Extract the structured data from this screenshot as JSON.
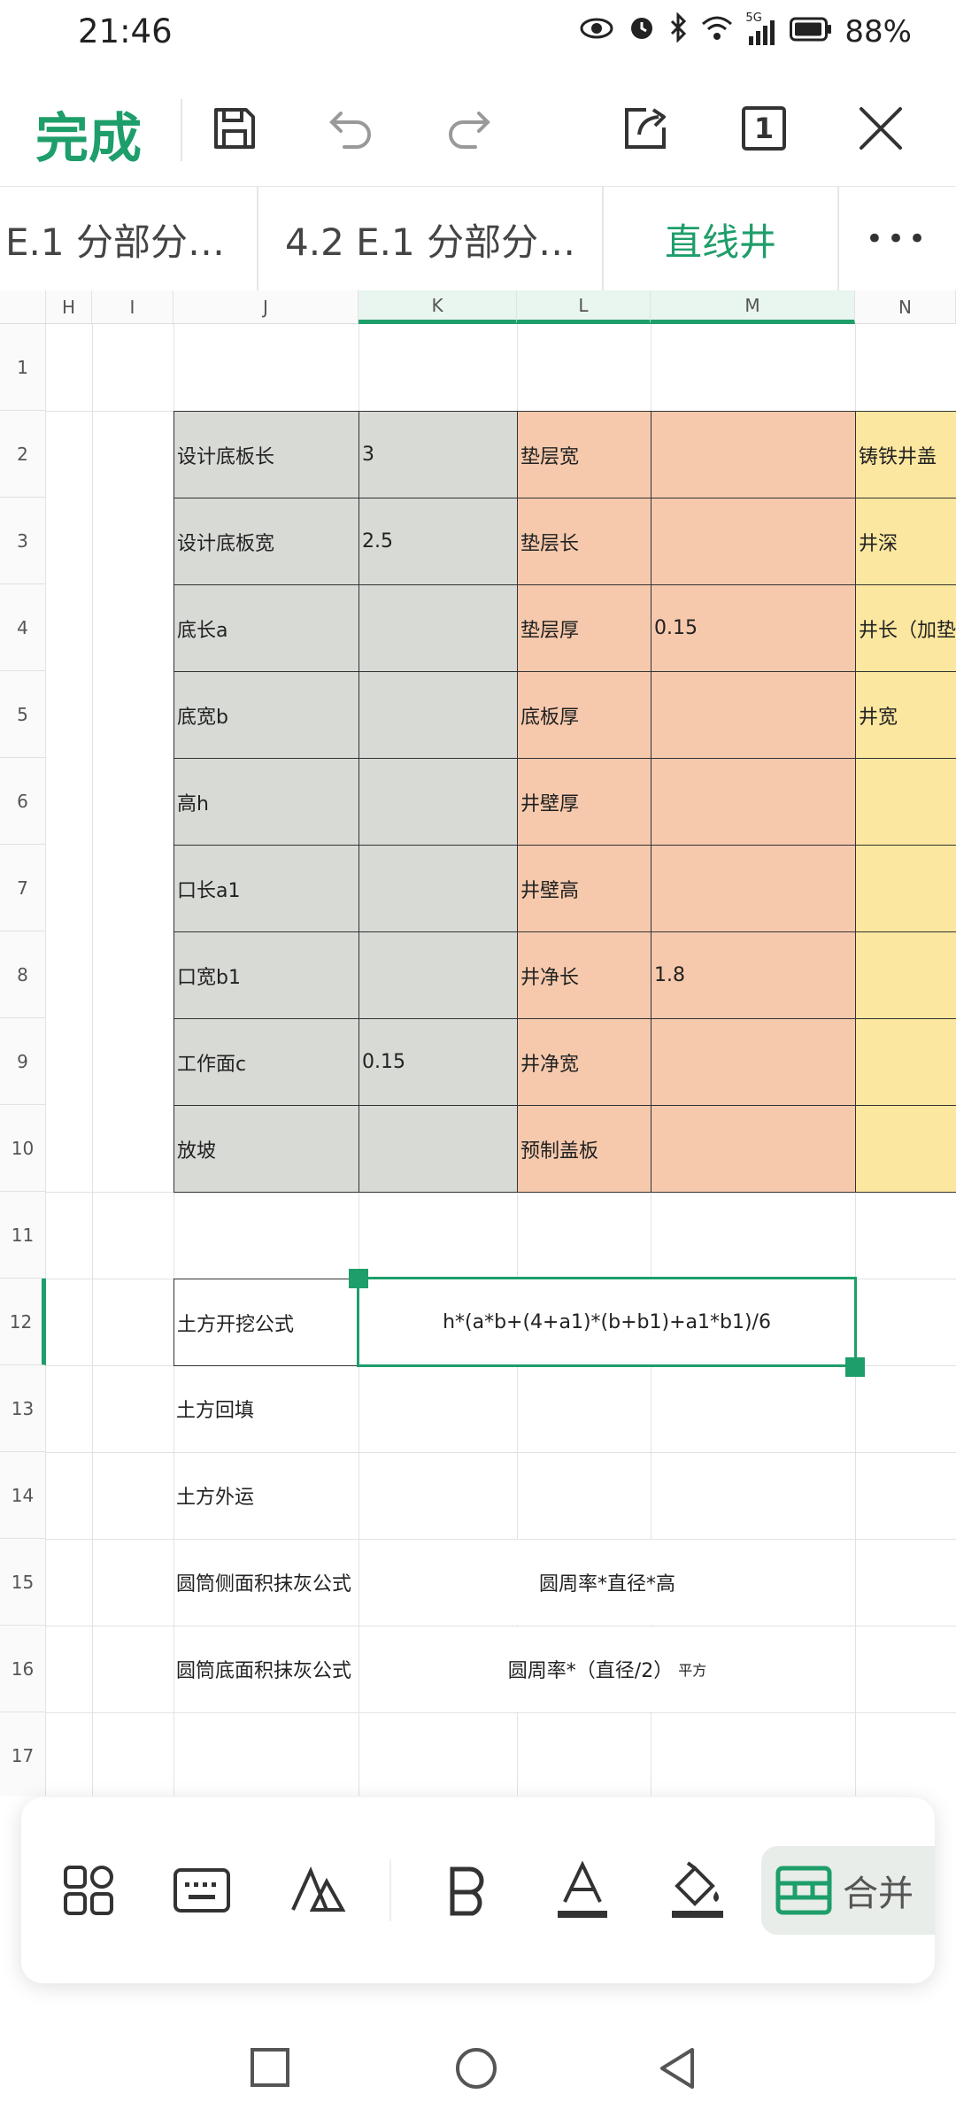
{
  "status_bar": {
    "time": "21:46",
    "battery": "88%",
    "network": "5G"
  },
  "toolbar": {
    "done_label": "完成",
    "page_count": "1",
    "icons": [
      "save-icon",
      "undo-icon",
      "redo-icon",
      "share-icon",
      "page-count-icon",
      "close-icon"
    ]
  },
  "sheet_tabs": {
    "items": [
      "E.1 分部分…",
      "4.2 E.1 分部分…",
      "直线井"
    ],
    "active": "直线井",
    "more_label": "•••"
  },
  "grid": {
    "columns": [
      "H",
      "I",
      "J",
      "K",
      "L",
      "M",
      "N"
    ],
    "selected_column": "K",
    "rows": [
      "1",
      "2",
      "3",
      "4",
      "5",
      "6",
      "7",
      "8",
      "9",
      "10",
      "11",
      "12",
      "13",
      "14",
      "15",
      "16",
      "17"
    ],
    "selected_row": "12",
    "cells": {
      "J2": "设计底板长",
      "K2": "3",
      "L2": "垫层宽",
      "M2": "",
      "N2": "铸铁井盖",
      "J3": "设计底板宽",
      "K3": "2.5",
      "L3": "垫层长",
      "M3": "",
      "N3": "井深",
      "J4": "底长a",
      "K4": "",
      "L4": "垫层厚",
      "M4": "0.15",
      "N4": "井长（加垫",
      "J5": "底宽b",
      "K5": "",
      "L5": "底板厚",
      "M5": "",
      "N5": "井宽",
      "J6": "高h",
      "K6": "",
      "L6": "井壁厚",
      "M6": "",
      "J7": "口长a1",
      "K7": "",
      "L7": "井壁高",
      "M7": "",
      "J8": "口宽b1",
      "K8": "",
      "L8": "井净长",
      "M8": "1.8",
      "J9": "工作面c",
      "K9": "0.15",
      "L9": "井净宽",
      "M9": "",
      "J10": "放坡",
      "K10": "",
      "L10": "预制盖板",
      "M10": "",
      "J12": "土方开挖公式",
      "K12": "h*(a*b+(4+a1)*(b+b1)+a1*b1)/6",
      "J13": "土方回填",
      "J14": "土方外运",
      "J15": "圆筒侧面积抹灰公式",
      "K15": "圆周率*直径*高",
      "J16": "圆筒底面积抹灰公式",
      "K16_main": "圆周率*（直径/2）",
      "K16_suffix": "平方"
    },
    "colors": {
      "gray": "#d8dad6",
      "orange": "#f6c9ad",
      "yellow": "#fbe79f",
      "accent": "#1e9e6a"
    }
  },
  "format_toolbar": {
    "items": [
      "apps-icon",
      "keyboard-icon",
      "clear-format-icon",
      "bold-icon",
      "font-color-icon",
      "fill-color-icon",
      "cell-format-icon"
    ],
    "merge_label": "合并"
  },
  "nav_bar": {
    "icons": [
      "recents-square-icon",
      "home-circle-icon",
      "back-triangle-icon"
    ]
  }
}
